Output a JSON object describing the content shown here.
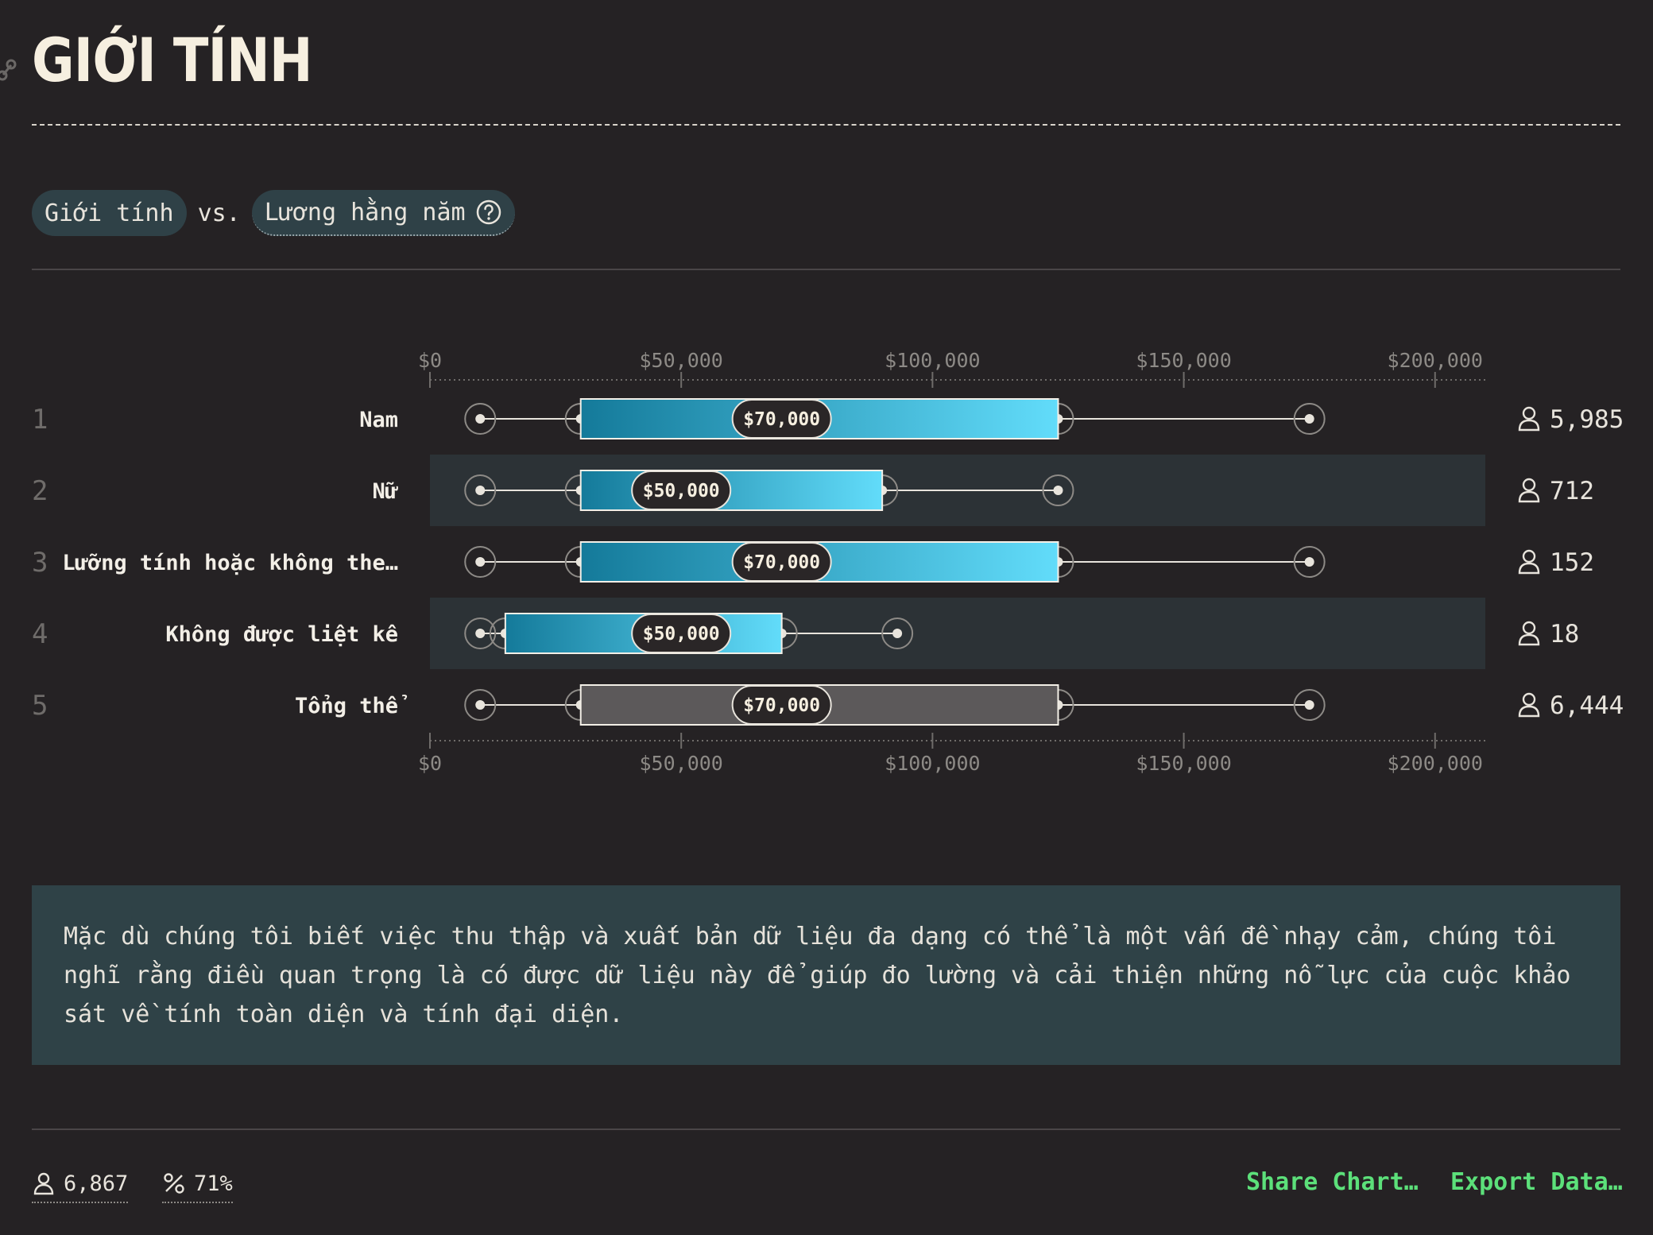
{
  "header": {
    "title": "GIỚI TÍNH"
  },
  "selectors": {
    "field_a": "Giới tính",
    "vs": "vs.",
    "field_b": "Lương hằng năm"
  },
  "chart_data": {
    "type": "boxplot",
    "xlim": [
      0,
      210000
    ],
    "ticks": [
      {
        "value": 0,
        "label": "$0"
      },
      {
        "value": 50000,
        "label": "$50,000"
      },
      {
        "value": 100000,
        "label": "$100,000"
      },
      {
        "value": 150000,
        "label": "$150,000"
      },
      {
        "value": 200000,
        "label": "$200,000"
      }
    ],
    "rows": [
      {
        "rank": "1",
        "label": "Nam",
        "p10": 10000,
        "q1": 30000,
        "median": 70000,
        "median_label": "$70,000",
        "q3": 125000,
        "p90": 175000,
        "count": "5,985",
        "highlight": false,
        "color": "teal"
      },
      {
        "rank": "2",
        "label": "Nữ",
        "p10": 10000,
        "q1": 30000,
        "median": 50000,
        "median_label": "$50,000",
        "q3": 90000,
        "p90": 125000,
        "count": "712",
        "highlight": true,
        "color": "teal"
      },
      {
        "rank": "3",
        "label": "Lưỡng tính hoặc không the…",
        "p10": 10000,
        "q1": 30000,
        "median": 70000,
        "median_label": "$70,000",
        "q3": 125000,
        "p90": 175000,
        "count": "152",
        "highlight": false,
        "color": "teal"
      },
      {
        "rank": "4",
        "label": "Không được liệt kê",
        "p10": 10000,
        "q1": 15000,
        "median": 50000,
        "median_label": "$50,000",
        "q3": 70000,
        "p90": 93000,
        "count": "18",
        "highlight": true,
        "color": "teal"
      },
      {
        "rank": "5",
        "label": "Tổng thể",
        "p10": 10000,
        "q1": 30000,
        "median": 70000,
        "median_label": "$70,000",
        "q3": 125000,
        "p90": 175000,
        "count": "6,444",
        "highlight": false,
        "color": "gray"
      }
    ]
  },
  "note": {
    "text": "Mặc dù chúng tôi biết việc thu thập và xuất bản dữ liệu đa dạng có thể là một vấn đề nhạy cảm, chúng tôi nghĩ rằng điều quan trọng là có được dữ liệu này để giúp đo lường và cải thiện những nỗ lực của cuộc khảo sát về tính toàn diện và tính đại diện."
  },
  "footer": {
    "respondents": "6,867",
    "percent": "71%",
    "share_label": "Share Chart…",
    "export_label": "Export Data…"
  },
  "colors": {
    "background": "#252224",
    "row_highlight": "#2c3236",
    "bar_start": "#147a9a",
    "bar_end": "#62dcfa",
    "accent_green": "#5ce07a"
  }
}
